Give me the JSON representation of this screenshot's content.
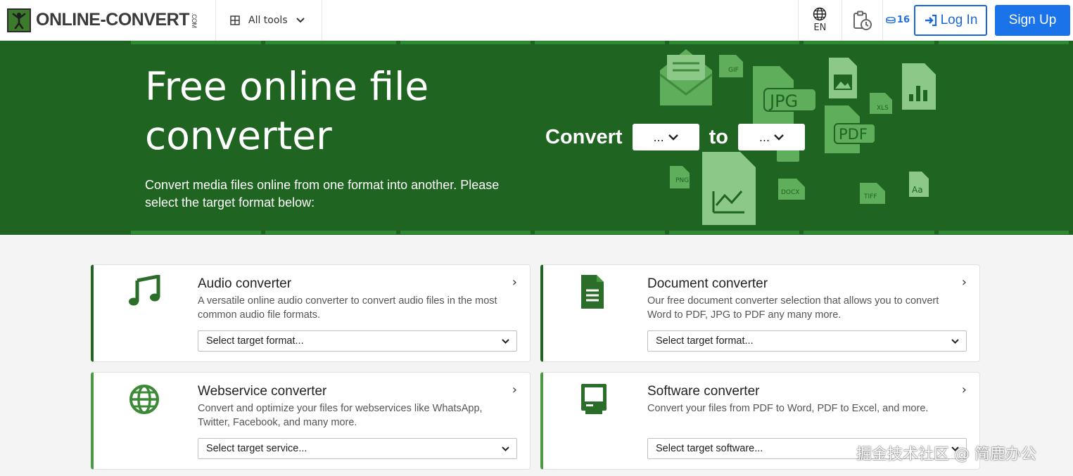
{
  "header": {
    "logo_text": "ONLINE-CONVERT",
    "logo_suffix": ".COM",
    "all_tools_label": "All tools",
    "language": "EN",
    "credits_count": "16",
    "login_label": "Log In",
    "signup_label": "Sign Up",
    "colors": {
      "login": "#1a66d9",
      "signup": "#1a73e8"
    }
  },
  "hero": {
    "title": "Free online file converter",
    "subtitle": "Convert media files online from one format into another. Please select the target format below:",
    "convert_label": "Convert",
    "to_label": "to",
    "from_select_value": "...",
    "to_select_value": "...",
    "file_badges": [
      "GIF",
      "JPG",
      "XLS",
      "PDF",
      "PNG",
      "DOCX",
      "TIFF",
      "Aa"
    ],
    "background_color": "#1f6421"
  },
  "cards": [
    {
      "icon": "music-note-icon",
      "title": "Audio converter",
      "description": "A versatile online audio converter to convert audio files in the most common audio file formats.",
      "select_placeholder": "Select target format..."
    },
    {
      "icon": "document-icon",
      "title": "Document converter",
      "description": "Our free document converter selection that allows you to convert Word to PDF, JPG to PDF any many more.",
      "select_placeholder": "Select target format..."
    },
    {
      "icon": "globe-icon",
      "title": "Webservice converter",
      "description": "Convert and optimize your files for webservices like WhatsApp, Twitter, Facebook, and many more.",
      "select_placeholder": "Select target service..."
    },
    {
      "icon": "computer-icon",
      "title": "Software converter",
      "description": "Convert your files from PDF to Word, PDF to Excel, and more.",
      "select_placeholder": "Select target software..."
    }
  ],
  "watermark": "掘金技术社区 @ 简鹿办公"
}
